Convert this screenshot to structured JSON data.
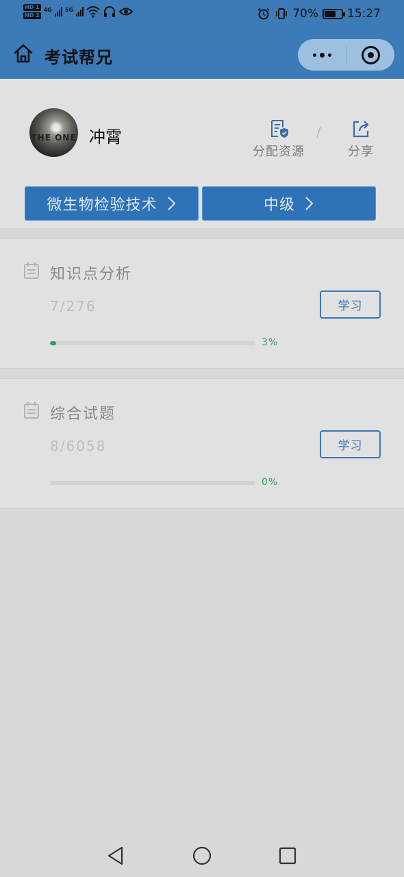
{
  "status_bar": {
    "sim1": "HD 1",
    "sim2": "HD 2",
    "net1": "4G",
    "net2": "5G",
    "battery_percent": "70%",
    "battery_level": 0.7,
    "time": "15:27",
    "icons": [
      "signal-icon",
      "wifi-icon",
      "headphones-icon",
      "eye-icon",
      "alarm-icon",
      "vibrate-icon",
      "battery-icon"
    ]
  },
  "nav": {
    "title": "考试帮兄",
    "home_icon": "home-icon",
    "more_icon": "more-dots-icon",
    "close_icon": "target-close-icon"
  },
  "profile": {
    "avatar_text": "THE ONE",
    "name": "冲霄",
    "actions": [
      {
        "label": "分配资源",
        "icon": "document-shield-icon"
      },
      {
        "label": "分享",
        "icon": "share-icon"
      }
    ],
    "separator": "/"
  },
  "selectors": {
    "subject": "微生物检验技术",
    "level": "中级"
  },
  "modules": [
    {
      "title": "知识点分析",
      "count": "7/276",
      "button": "学习",
      "progress": 0.03,
      "progress_label": "3%"
    },
    {
      "title": "综合试题",
      "count": "8/6058",
      "button": "学习",
      "progress": 0.0,
      "progress_label": "0%"
    }
  ],
  "colors": {
    "header_blue": "#3d7ab8",
    "button_blue": "#2e72b8",
    "progress_green": "#2f9e58",
    "page_bg": "#d8d8da",
    "card_bg": "#e1e1e1"
  }
}
